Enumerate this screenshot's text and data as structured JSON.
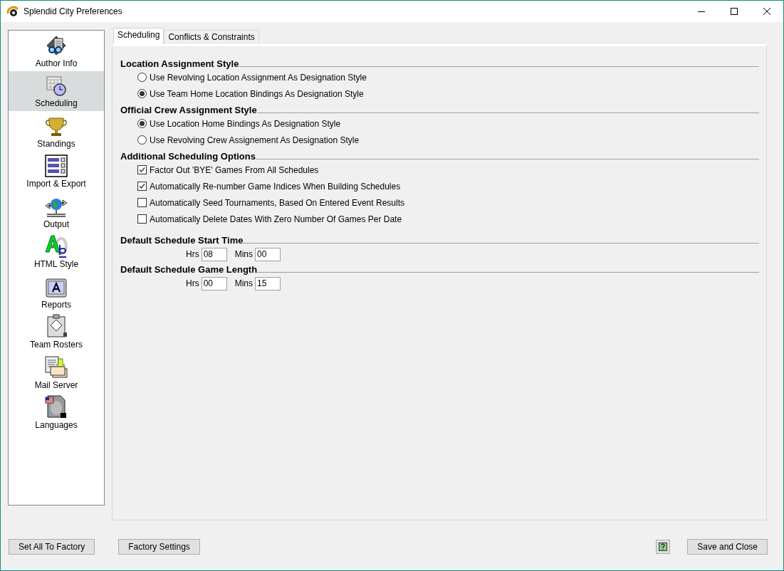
{
  "window": {
    "title": "Splendid City Preferences"
  },
  "sidebar": {
    "items": [
      {
        "label": "Author Info",
        "selected": false
      },
      {
        "label": "Scheduling",
        "selected": true
      },
      {
        "label": "Standings",
        "selected": false
      },
      {
        "label": "Import & Export",
        "selected": false
      },
      {
        "label": "Output",
        "selected": false
      },
      {
        "label": "HTML Style",
        "selected": false
      },
      {
        "label": "Reports",
        "selected": false
      },
      {
        "label": "Team Rosters",
        "selected": false
      },
      {
        "label": "Mail Server",
        "selected": false
      },
      {
        "label": "Languages",
        "selected": false
      }
    ]
  },
  "tabs": [
    {
      "label": "Scheduling",
      "selected": true
    },
    {
      "label": "Conflicts & Constraints",
      "selected": false
    }
  ],
  "sections": [
    {
      "title": "Location Assignment Style",
      "kind": "radio",
      "options": [
        {
          "label": "Use Revolving Location Assignment As Designation Style",
          "selected": false
        },
        {
          "label": "Use Team Home Location Bindings As Designation Style",
          "selected": true
        }
      ]
    },
    {
      "title": "Official Crew Assignment Style",
      "kind": "radio",
      "options": [
        {
          "label": "Use Location Home Bindings As Designation Style",
          "selected": true
        },
        {
          "label": "Use Revolving Crew Assignement As Designation Style",
          "selected": false
        }
      ]
    },
    {
      "title": "Additional Scheduling Options",
      "kind": "checkbox",
      "options": [
        {
          "label": "Factor Out 'BYE' Games From All Schedules",
          "checked": true
        },
        {
          "label": "Automatically Re-number Game Indices When Building Schedules",
          "checked": true
        },
        {
          "label": "Automatically Seed Tournaments, Based On Entered Event Results",
          "checked": false
        },
        {
          "label": "Automatically Delete Dates With Zero Number Of Games Per Date",
          "checked": false
        }
      ]
    },
    {
      "title": "Default Schedule Start Time",
      "kind": "time",
      "hours_label": "Hrs",
      "hours": "08",
      "minutes_label": "Mins",
      "minutes": "00"
    },
    {
      "title": "Default Schedule Game Length",
      "kind": "time",
      "hours_label": "Hrs",
      "hours": "00",
      "minutes_label": "Mins",
      "minutes": "15"
    }
  ],
  "footer": {
    "left_buttons": [
      "Set All To Factory",
      "Factory Settings"
    ],
    "right_button": "Save and Close"
  }
}
